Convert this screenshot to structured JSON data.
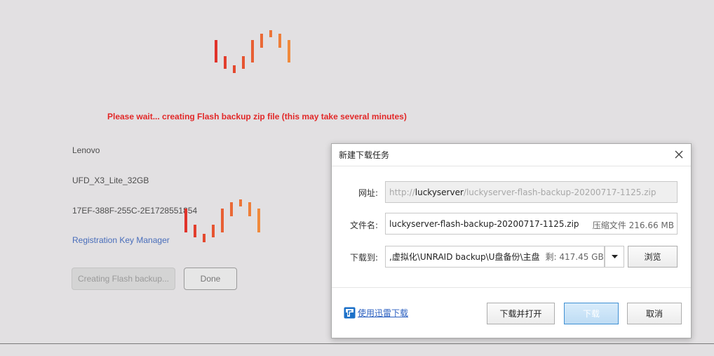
{
  "page": {
    "wait_message": "Please wait... creating Flash backup zip file (this may take several minutes)",
    "device_vendor": "Lenovo",
    "device_product": "UFD_X3_Lite_32GB",
    "device_guid": "17EF-388F-255C-2E1728551854",
    "registration_link": "Registration Key Manager",
    "creating_button": "Creating Flash backup...",
    "done_button": "Done"
  },
  "dialog": {
    "title": "新建下载任务",
    "url_label": "网址:",
    "url_prefix": "http://",
    "url_host": "luckyserver",
    "url_path": "/luckyserver-flash-backup-20200717-1125.zip",
    "filename_label": "文件名:",
    "filename": "luckyserver-flash-backup-20200717-1125.zip",
    "file_info": "压缩文件 216.66 MB",
    "saveto_label": "下载到:",
    "saveto_path": ",虚拟化\\UNRAID backup\\U盘备份\\主盘",
    "space_info": "剩: 417.45 GB",
    "browse_button": "浏览",
    "thunder_link": "使用迅雷下载",
    "download_open_button": "下载并打开",
    "download_button": "下载",
    "cancel_button": "取消"
  },
  "colors": {
    "background": "#e2e0e2",
    "wait_text": "#e22828",
    "link": "#486dba",
    "loader_start": "#e0332b",
    "loader_end": "#f08a3c"
  },
  "icons": {
    "close": "close-icon",
    "dropdown": "chevron-down-icon",
    "thunder": "thunder-icon",
    "loader": "spinner-icon"
  }
}
